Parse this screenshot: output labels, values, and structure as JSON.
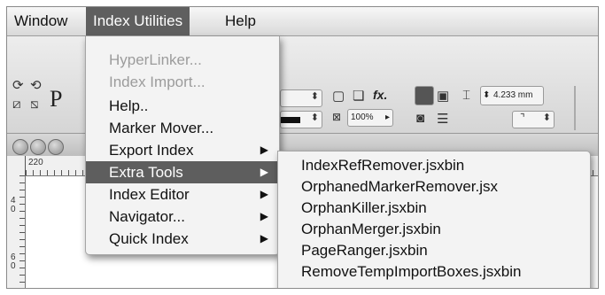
{
  "menubar": {
    "items": [
      {
        "label": "Window"
      },
      {
        "label": "Index Utilities"
      },
      {
        "label": "Help"
      }
    ]
  },
  "toolbar": {
    "zoom_value": "100%",
    "size_value": "4.233 mm",
    "fx_label": "fx.",
    "partial_letter": "P"
  },
  "ruler": {
    "h_mark": "220",
    "v_marks": [
      "4",
      "0",
      "6",
      "0"
    ]
  },
  "dropdown": {
    "items": [
      {
        "label": "HyperLinker...",
        "enabled": false,
        "submenu": false
      },
      {
        "label": "Index Import...",
        "enabled": false,
        "submenu": false
      },
      {
        "label": "Help..",
        "enabled": true,
        "submenu": false
      },
      {
        "label": "Marker Mover...",
        "enabled": true,
        "submenu": false
      },
      {
        "label": "Export Index",
        "enabled": true,
        "submenu": true
      },
      {
        "label": "Extra Tools",
        "enabled": true,
        "submenu": true,
        "highlighted": true
      },
      {
        "label": "Index Editor",
        "enabled": true,
        "submenu": true
      },
      {
        "label": "Navigator...",
        "enabled": true,
        "submenu": true
      },
      {
        "label": "Quick Index",
        "enabled": true,
        "submenu": true
      }
    ],
    "chevron_icon": "▶"
  },
  "submenu": {
    "items": [
      {
        "label": "IndexRefRemover.jsxbin"
      },
      {
        "label": "OrphanedMarkerRemover.jsx"
      },
      {
        "label": "OrphanKiller.jsxbin"
      },
      {
        "label": "OrphanMerger.jsxbin"
      },
      {
        "label": "PageRanger.jsxbin"
      },
      {
        "label": "RemoveTempImportBoxes.jsxbin"
      }
    ]
  }
}
